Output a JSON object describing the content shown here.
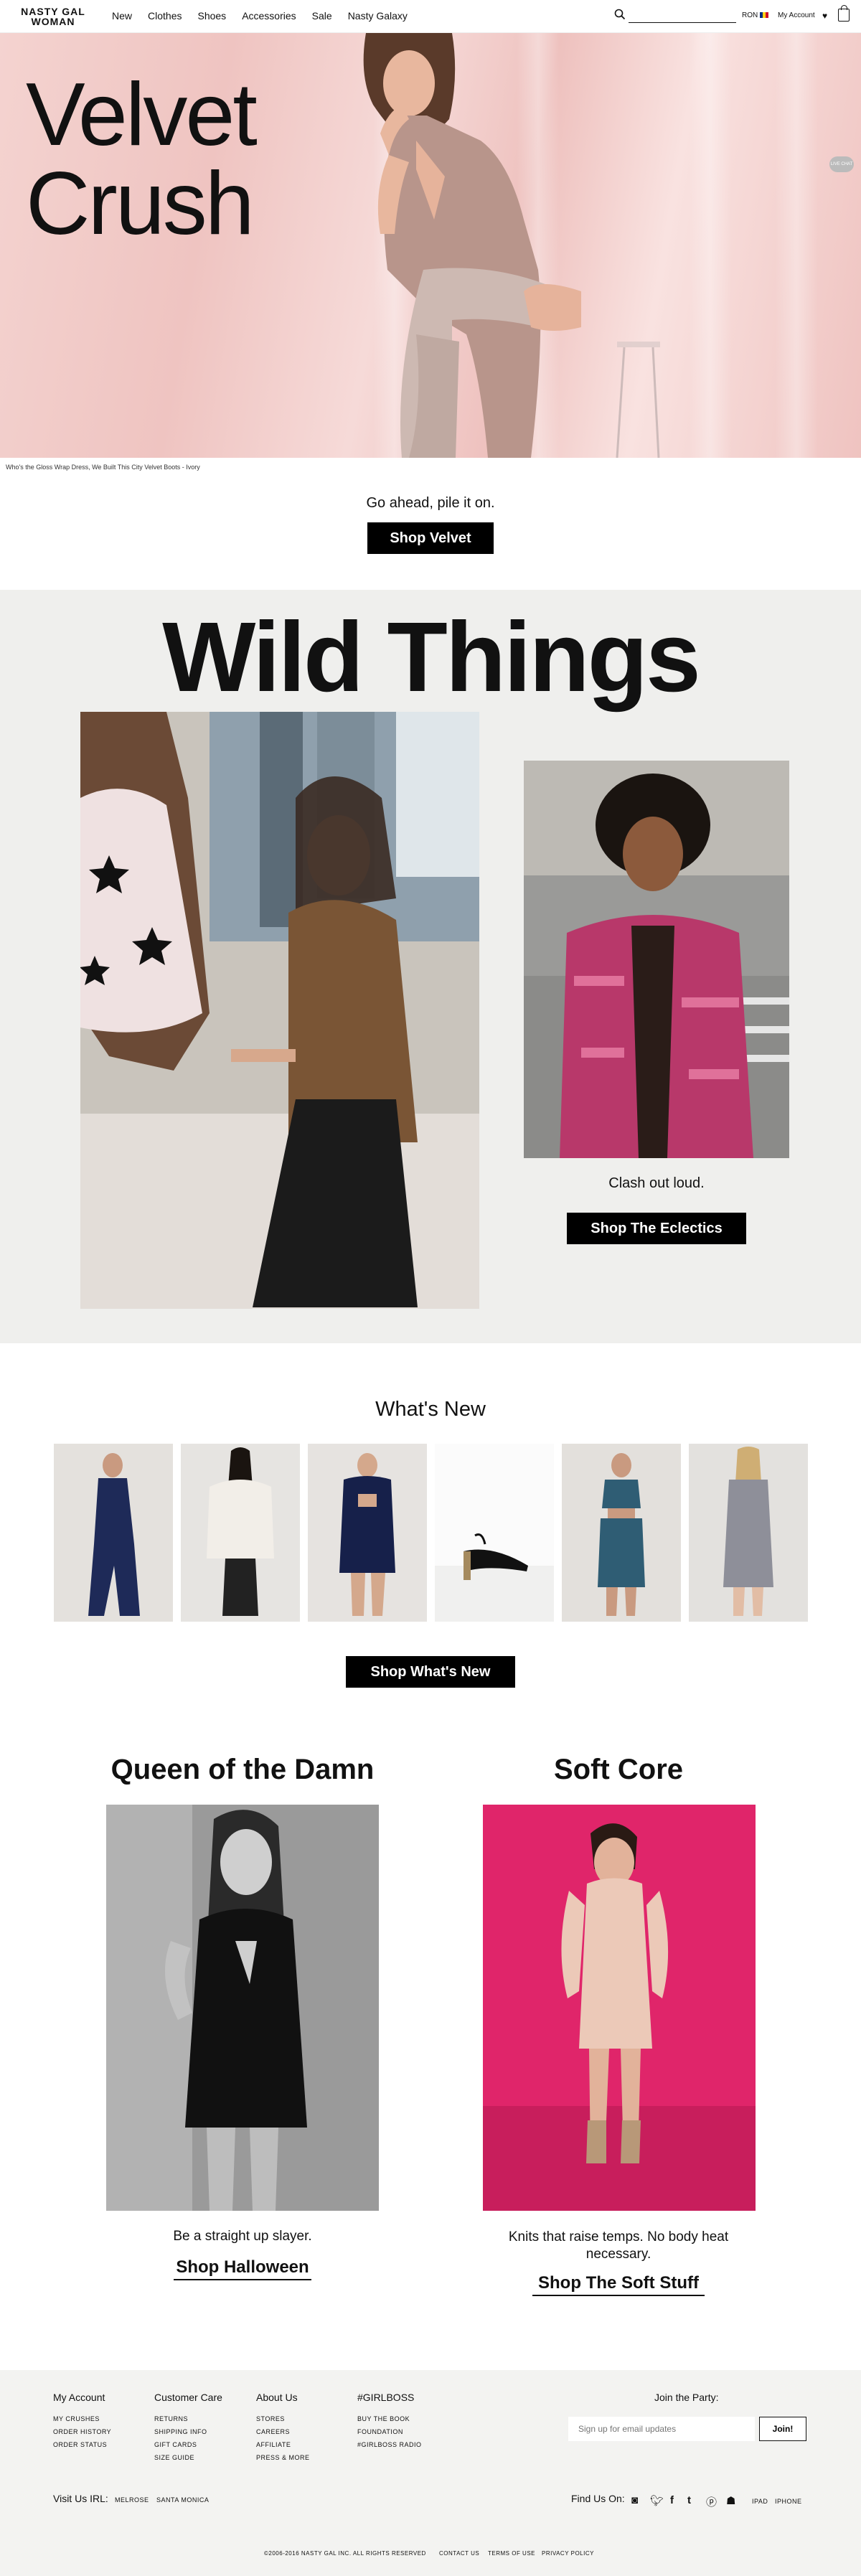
{
  "header": {
    "logo_line1": "NASTY GAL",
    "logo_line2": "WOMAN",
    "nav": [
      "New",
      "Clothes",
      "Shoes",
      "Accessories",
      "Sale",
      "Nasty Galaxy"
    ],
    "search_placeholder": "",
    "currency": "RON",
    "account": "My Account"
  },
  "hero": {
    "title_line1": "Velvet",
    "title_line2": "Crush",
    "chat_badge": "LIVE CHAT",
    "caption": "Who's the Gloss Wrap Dress, We Built This City Velvet Boots - Ivory",
    "tagline": "Go ahead, pile it on.",
    "button": "Shop Velvet"
  },
  "wild": {
    "title": "Wild Things",
    "tagline": "Clash out loud.",
    "button": "Shop The Eclectics"
  },
  "whats_new": {
    "title": "What's New",
    "button": "Shop What's New"
  },
  "promos": [
    {
      "title": "Queen of the Damn",
      "tagline": "Be a straight up slayer.",
      "link": "Shop Halloween"
    },
    {
      "title": "Soft Core",
      "tagline_line1": "Knits that raise temps. No body heat",
      "tagline_line2": "necessary.",
      "link": "Shop The Soft Stuff"
    }
  ],
  "footer": {
    "columns": [
      {
        "title": "My Account",
        "links": [
          "MY CRUSHES",
          "ORDER HISTORY",
          "ORDER STATUS"
        ]
      },
      {
        "title": "Customer Care",
        "links": [
          "RETURNS",
          "SHIPPING INFO",
          "GIFT CARDS",
          "SIZE GUIDE"
        ]
      },
      {
        "title": "About Us",
        "links": [
          "STORES",
          "CAREERS",
          "AFFILIATE",
          "PRESS & MORE"
        ]
      },
      {
        "title": "#GIRLBOSS",
        "links": [
          "BUY THE BOOK",
          "FOUNDATION",
          "#GIRLBOSS RADIO"
        ]
      }
    ],
    "join_title": "Join the Party:",
    "email_placeholder": "Sign up for email updates",
    "join_button": "Join!",
    "visit_label": "Visit Us IRL:",
    "stores": [
      "MELROSE",
      "SANTA MONICA"
    ],
    "find_label": "Find Us On:",
    "apps": [
      "IPAD",
      "IPHONE"
    ],
    "copyright": "©2006-2016 NASTY GAL INC. ALL RIGHTS RESERVED",
    "bottom_links": [
      "CONTACT US",
      "TERMS OF USE",
      "PRIVACY POLICY"
    ]
  }
}
